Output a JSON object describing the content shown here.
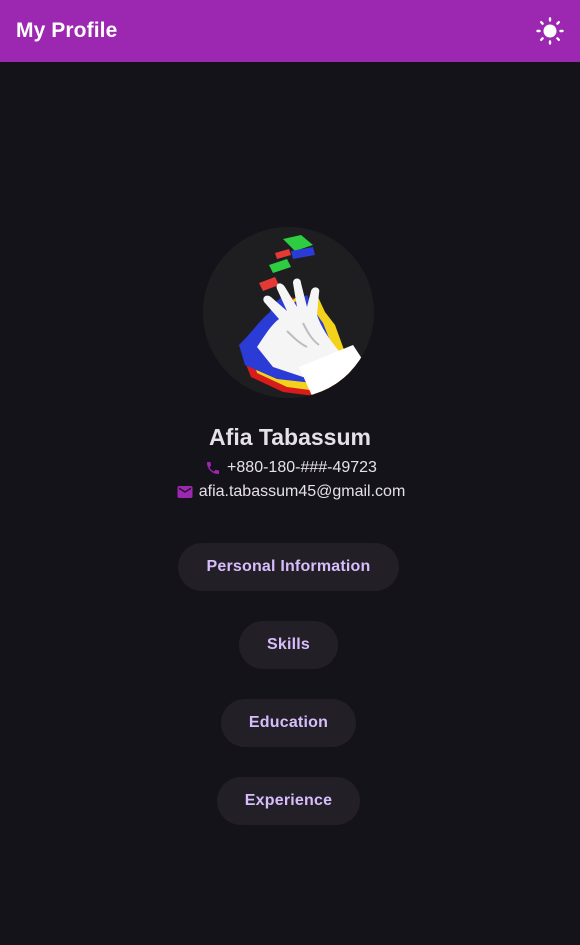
{
  "appbar": {
    "title": "My Profile",
    "theme_toggle_icon": "sun-icon",
    "color": "#9c27b0"
  },
  "profile": {
    "avatar": "profile-avatar-hand-glitch",
    "name": "Afia Tabassum",
    "phone": "+880-180-###-49723",
    "phone_icon": "phone-icon",
    "email": "afia.tabassum45@gmail.com",
    "email_icon": "mail-icon",
    "icon_color": "#9c27b0"
  },
  "sections": [
    {
      "label": "Personal Information"
    },
    {
      "label": "Skills"
    },
    {
      "label": "Education"
    },
    {
      "label": "Experience"
    }
  ],
  "colors": {
    "background": "#15131a",
    "button_background": "#221f27",
    "button_text": "#d7bdfb",
    "text": "#e6e1e9"
  }
}
